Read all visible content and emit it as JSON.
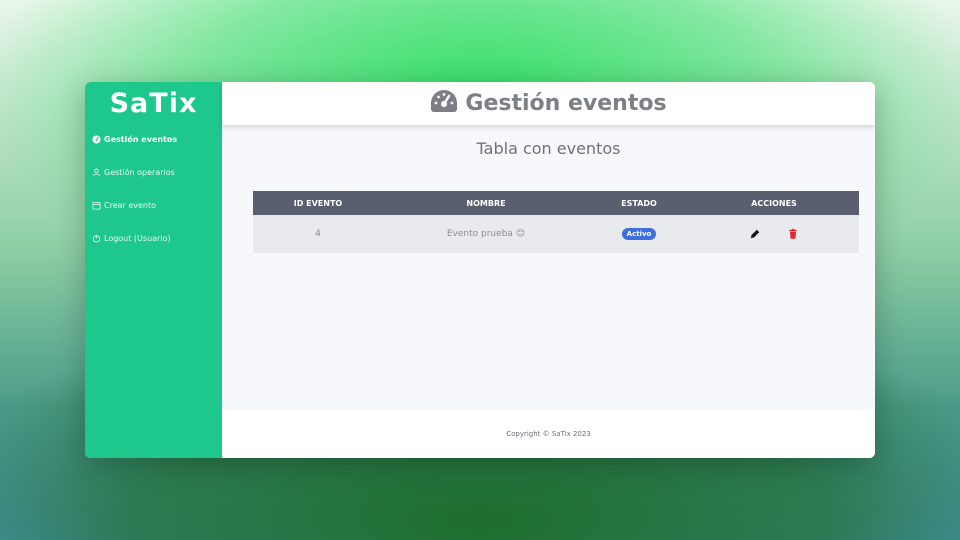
{
  "app": {
    "logo": "SaTix"
  },
  "sidebar": {
    "items": [
      {
        "label": "Gestión eventos",
        "icon": "gauge-icon",
        "active": true
      },
      {
        "label": "Gestión operarios",
        "icon": "user-icon",
        "active": false
      },
      {
        "label": "Crear evento",
        "icon": "calendar-icon",
        "active": false
      },
      {
        "label": "Logout (Usuario)",
        "icon": "power-icon",
        "active": false
      }
    ]
  },
  "header": {
    "title": "Gestión eventos",
    "icon": "gauge-icon"
  },
  "main": {
    "subtitle": "Tabla con eventos",
    "table": {
      "columns": [
        "ID EVENTO",
        "NOMBRE",
        "ESTADO",
        "ACCIONES"
      ],
      "rows": [
        {
          "id": "4",
          "name": "Evento prueba 😊",
          "status": "Activo"
        }
      ]
    }
  },
  "footer": {
    "copyright": "Copyright © SaTix 2023"
  },
  "colors": {
    "sidebar": "#1ec78b",
    "header_row": "#5a5f70",
    "badge": "#3e6fdc",
    "delete": "#e0252f"
  }
}
